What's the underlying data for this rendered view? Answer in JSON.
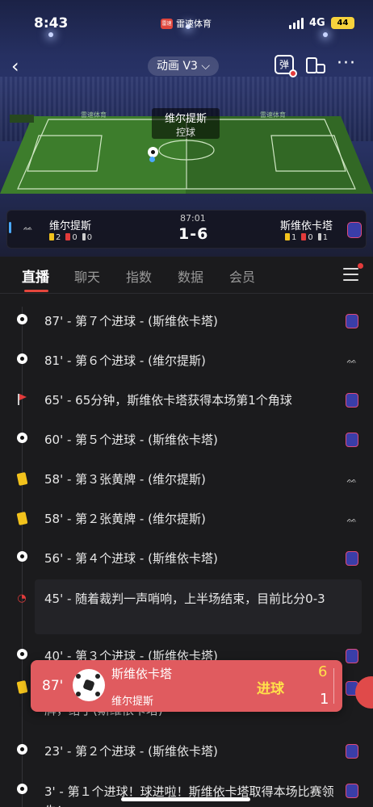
{
  "status_bar": {
    "time": "8:43",
    "app_logo_text": "雷速",
    "app_name": "雷速体育",
    "network": "4G",
    "battery": "44"
  },
  "nav": {
    "view_mode": "动画 V3 ⌵",
    "danmu_label": "弹"
  },
  "pitch": {
    "possession_team": "维尔提斯",
    "possession_action": "控球",
    "board_text": "雷速体育"
  },
  "match": {
    "home": {
      "name": "维尔提斯",
      "yellow": "2",
      "red": "0",
      "corners": "0"
    },
    "away": {
      "name": "斯维依卡塔",
      "yellow": "1",
      "red": "0",
      "corners": "1"
    },
    "time": "87:01",
    "score": "1-6"
  },
  "tabs": [
    {
      "label": "直播",
      "active": true
    },
    {
      "label": "聊天"
    },
    {
      "label": "指数"
    },
    {
      "label": "数据"
    },
    {
      "label": "会员"
    }
  ],
  "events": [
    {
      "icon": "ball",
      "text": "87' - 第７个进球 - (斯维依卡塔)",
      "team": "away"
    },
    {
      "icon": "ball",
      "text": "81' - 第６个进球 - (维尔提斯)",
      "team": "home"
    },
    {
      "icon": "corner",
      "text": "65' - 65分钟，斯维依卡塔获得本场第1个角球",
      "team": "away"
    },
    {
      "icon": "ball",
      "text": "60' - 第５个进球 - (斯维依卡塔)",
      "team": "away"
    },
    {
      "icon": "yellow",
      "text": "58' - 第３张黄牌 - (维尔提斯)",
      "team": "home"
    },
    {
      "icon": "yellow",
      "text": "58' - 第２张黄牌 - (维尔提斯)",
      "team": "home"
    },
    {
      "icon": "ball",
      "text": "56' - 第４个进球 - (斯维依卡塔)",
      "team": "away"
    },
    {
      "icon": "whistle",
      "text": "45' - 随着裁判一声哨响，上半场结束，目前比分0-3",
      "team": ""
    },
    {
      "icon": "ball",
      "text": "40' - 第３个进球 - (斯维依卡塔)",
      "team": "away"
    },
    {
      "icon": "yellow",
      "text": "39' - 第１张黄牌 - 裁判出示了本场比赛的第一张黄牌，给了(斯维依卡塔)",
      "team": "away"
    },
    {
      "icon": "ball",
      "text": "23' - 第２个进球 - (斯维依卡塔)",
      "team": "away"
    },
    {
      "icon": "ball",
      "text": "3' - 第１个进球！球进啦！斯维依卡塔取得本场比赛领先！",
      "team": "away"
    }
  ],
  "toast": {
    "minute": "87'",
    "scorer_team": "斯维依卡塔",
    "other_team": "维尔提斯",
    "label": "进球",
    "score_top": "6",
    "score_bottom": "1"
  }
}
